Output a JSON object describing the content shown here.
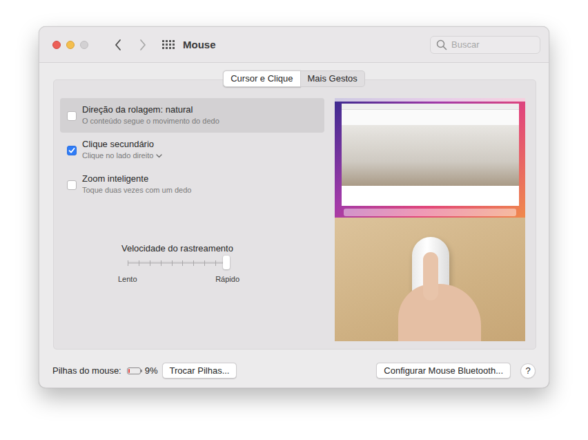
{
  "window": {
    "title": "Mouse"
  },
  "search": {
    "placeholder": "Buscar"
  },
  "tabs": [
    {
      "label": "Cursor e Clique",
      "selected": true
    },
    {
      "label": "Mais Gestos",
      "selected": false
    }
  ],
  "options": [
    {
      "kind": "checkbox",
      "title": "Direção da rolagem: natural",
      "subtitle": "O conteúdo segue o movimento do dedo",
      "checked": false,
      "selected": true,
      "has_menu": false
    },
    {
      "kind": "checkbox",
      "title": "Clique secundário",
      "subtitle": "Clique no lado direito",
      "checked": true,
      "selected": false,
      "has_menu": true
    },
    {
      "kind": "checkbox",
      "title": "Zoom inteligente",
      "subtitle": "Toque duas vezes com um dedo",
      "checked": false,
      "selected": false,
      "has_menu": false
    }
  ],
  "slider": {
    "label": "Velocidade do rastreamento",
    "level": 1,
    "min_label": "Lento",
    "max_label": "Rápido"
  },
  "battery": {
    "label": "Pilhas do mouse:",
    "level": 0.09,
    "reading": "9%",
    "button": "Trocar Pilhas..."
  },
  "buttons": [
    "Configurar Mouse Bluetooth...",
    "?"
  ]
}
